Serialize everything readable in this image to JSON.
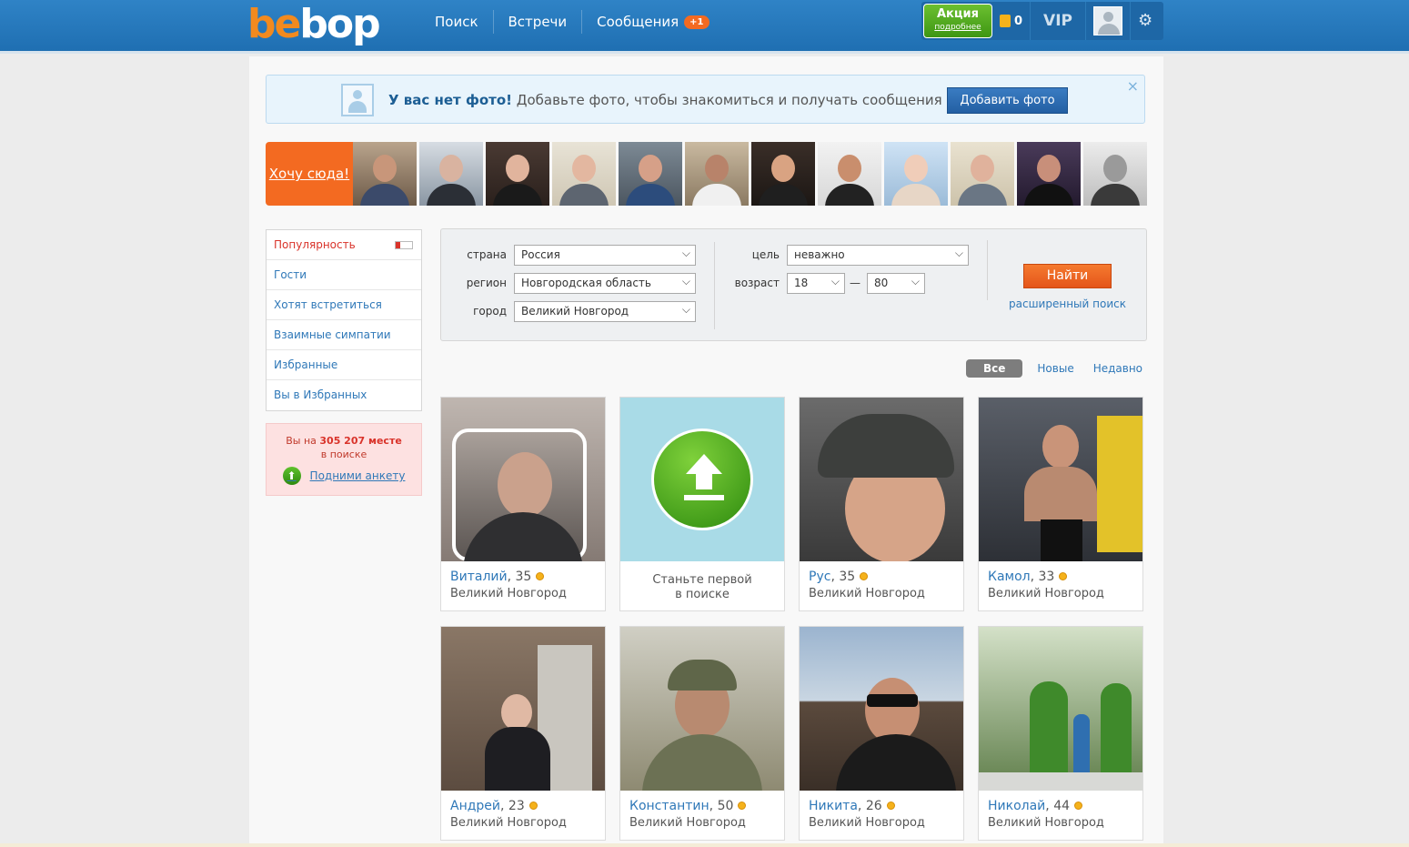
{
  "header": {
    "logo": "bebop",
    "nav": [
      {
        "label": "Поиск"
      },
      {
        "label": "Встречи"
      },
      {
        "label": "Сообщения",
        "badge": "+1"
      }
    ],
    "promo_title": "Акция",
    "promo_sub": "подробнее",
    "coins": "0",
    "vip": "VIP"
  },
  "banner": {
    "bold": "У вас нет фото!",
    "text": " Добавьте фото, чтобы знакомиться и получать сообщения",
    "button": "Добавить фото",
    "close": "×"
  },
  "strip": {
    "cta": "Хочу сюда!",
    "thumb_count": 12
  },
  "sidebar": {
    "items": [
      {
        "label": "Популярность",
        "active": true,
        "level": 0.3
      },
      {
        "label": "Гости"
      },
      {
        "label": "Хотят встретиться"
      },
      {
        "label": "Взаимные симпатии"
      },
      {
        "label": "Избранные"
      },
      {
        "label": "Вы в Избранных"
      }
    ],
    "rank_prefix": "Вы на ",
    "rank_value": "305 207 месте",
    "rank_suffix": "в поиске",
    "raise_link": "Подними анкету"
  },
  "search": {
    "country_label": "страна",
    "country_value": "Россия",
    "region_label": "регион",
    "region_value": "Новгородская область",
    "city_label": "город",
    "city_value": "Великий Новгород",
    "goal_label": "цель",
    "goal_value": "неважно",
    "age_label": "возраст",
    "age_from": "18",
    "age_dash": "—",
    "age_to": "80",
    "find_button": "Найти",
    "advanced_link": "расширенный поиск"
  },
  "filters": [
    "Все",
    "Новые",
    "Недавно"
  ],
  "promo_card": {
    "line1": "Станьте первой",
    "line2": "в поиске"
  },
  "cards": [
    {
      "name": "Виталий",
      "age": "35",
      "city": "Великий Новгород"
    },
    {
      "name": "Рус",
      "age": "35",
      "city": "Великий Новгород"
    },
    {
      "name": "Камол",
      "age": "33",
      "city": "Великий Новгород"
    },
    {
      "name": "Андрей",
      "age": "23",
      "city": "Великий Новгород"
    },
    {
      "name": "Константин",
      "age": "50",
      "city": "Великий Новгород"
    },
    {
      "name": "Никита",
      "age": "26",
      "city": "Великий Новгород"
    },
    {
      "name": "Николай",
      "age": "44",
      "city": "Великий Новгород"
    }
  ],
  "colors": {
    "header": "#2579bd",
    "accent": "#f36a21",
    "link": "#2f78b8",
    "online": "#f5b21b"
  }
}
